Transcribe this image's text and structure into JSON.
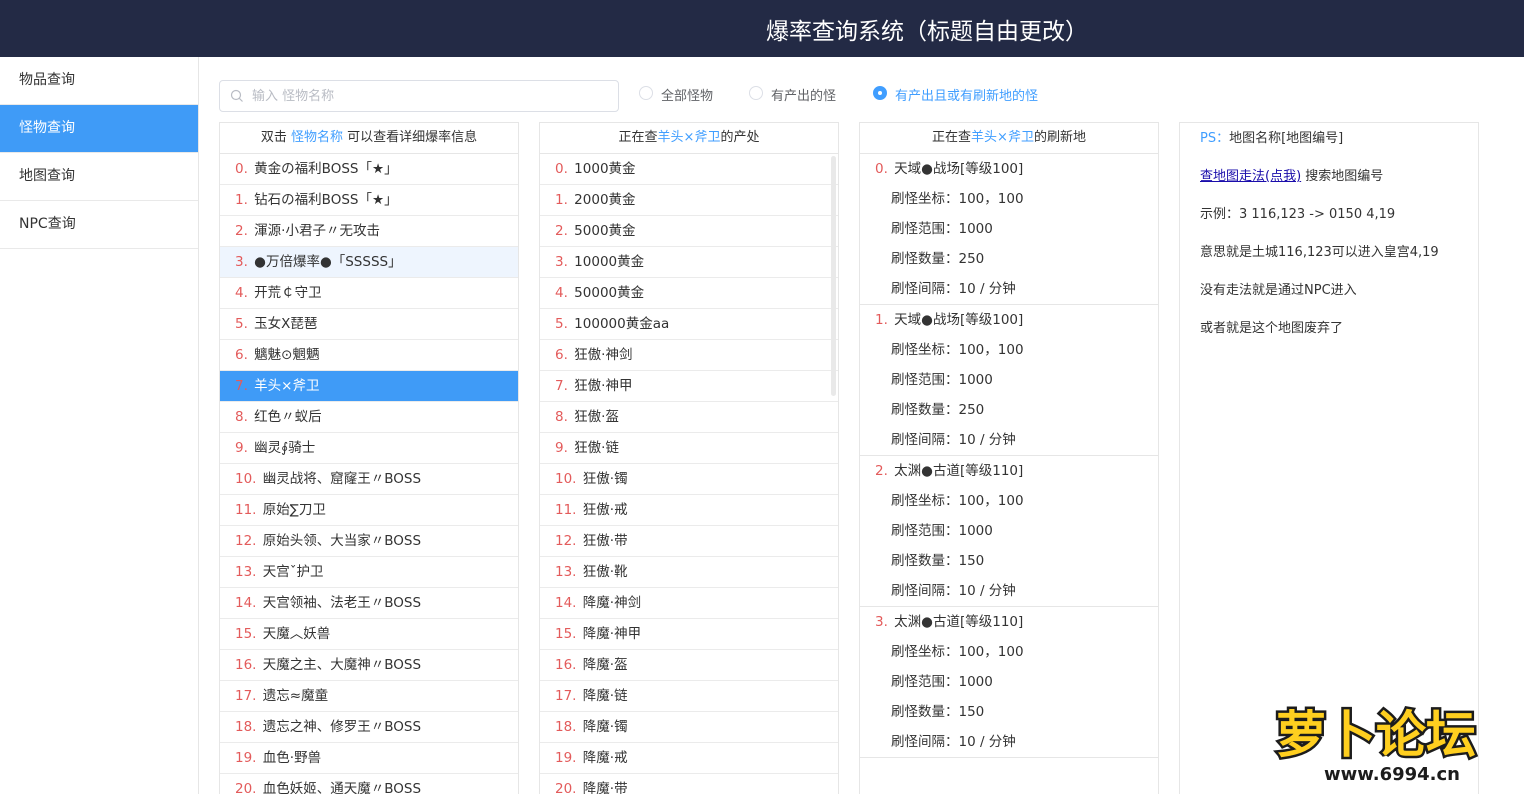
{
  "header": {
    "title": "爆率查询系统（标题自由更改）"
  },
  "sidebar": {
    "items": [
      {
        "label": "物品查询"
      },
      {
        "label": "怪物查询"
      },
      {
        "label": "地图查询"
      },
      {
        "label": "NPC查询"
      }
    ],
    "active_index": 1
  },
  "search": {
    "placeholder": "输入 怪物名称",
    "value": ""
  },
  "filters": [
    {
      "label": "全部怪物",
      "checked": false
    },
    {
      "label": "有产出的怪",
      "checked": false
    },
    {
      "label": "有产出且或有刷新地的怪",
      "checked": true
    }
  ],
  "monster_panel": {
    "head_pre": "双击",
    "head_hl": "怪物名称",
    "head_post": "可以查看详细爆率信息",
    "selected_index": 7,
    "hover_index": 3,
    "items": [
      {
        "idx": "0.",
        "name": "黄金の福利BOSS「★」"
      },
      {
        "idx": "1.",
        "name": "钻石の福利BOSS「★」"
      },
      {
        "idx": "2.",
        "name": "渾源·小君子〃无攻击"
      },
      {
        "idx": "3.",
        "name": "●万倍爆率●「SSSSS」"
      },
      {
        "idx": "4.",
        "name": "开荒￠守卫"
      },
      {
        "idx": "5.",
        "name": "玉女Ⅹ琵琶"
      },
      {
        "idx": "6.",
        "name": "魑魅⊙魍魉"
      },
      {
        "idx": "7.",
        "name": "羊头×斧卫"
      },
      {
        "idx": "8.",
        "name": "红色〃蚁后"
      },
      {
        "idx": "9.",
        "name": "幽灵∮骑士"
      },
      {
        "idx": "10.",
        "name": "幽灵战将、窟窿王〃BOSS"
      },
      {
        "idx": "11.",
        "name": "原始∑刀卫"
      },
      {
        "idx": "12.",
        "name": "原始头领、大当家〃BOSS"
      },
      {
        "idx": "13.",
        "name": "天宫ˇ护卫"
      },
      {
        "idx": "14.",
        "name": "天宫领袖、法老王〃BOSS"
      },
      {
        "idx": "15.",
        "name": "天魔︿妖兽"
      },
      {
        "idx": "16.",
        "name": "天魔之主、大魔神〃BOSS"
      },
      {
        "idx": "17.",
        "name": "遗忘≈魔童"
      },
      {
        "idx": "18.",
        "name": "遗忘之神、修罗王〃BOSS"
      },
      {
        "idx": "19.",
        "name": "血色·野兽"
      },
      {
        "idx": "20.",
        "name": "血色妖姬、通天魔〃BOSS"
      }
    ]
  },
  "drop_panel": {
    "head_pre": "正在查",
    "head_hl": "羊头×斧卫",
    "head_post": "的产处",
    "items": [
      {
        "idx": "0.",
        "name": "1000黄金"
      },
      {
        "idx": "1.",
        "name": "2000黄金"
      },
      {
        "idx": "2.",
        "name": "5000黄金"
      },
      {
        "idx": "3.",
        "name": "10000黄金"
      },
      {
        "idx": "4.",
        "name": "50000黄金"
      },
      {
        "idx": "5.",
        "name": "100000黄金aa"
      },
      {
        "idx": "6.",
        "name": "狂傲·神剑"
      },
      {
        "idx": "7.",
        "name": "狂傲·神甲"
      },
      {
        "idx": "8.",
        "name": "狂傲·盔"
      },
      {
        "idx": "9.",
        "name": "狂傲·链"
      },
      {
        "idx": "10.",
        "name": "狂傲·镯"
      },
      {
        "idx": "11.",
        "name": "狂傲·戒"
      },
      {
        "idx": "12.",
        "name": "狂傲·带"
      },
      {
        "idx": "13.",
        "name": "狂傲·靴"
      },
      {
        "idx": "14.",
        "name": "降魔·神剑"
      },
      {
        "idx": "15.",
        "name": "降魔·神甲"
      },
      {
        "idx": "16.",
        "name": "降魔·盔"
      },
      {
        "idx": "17.",
        "name": "降魔·链"
      },
      {
        "idx": "18.",
        "name": "降魔·镯"
      },
      {
        "idx": "19.",
        "name": "降魔·戒"
      },
      {
        "idx": "20.",
        "name": "降魔·带"
      }
    ]
  },
  "map_panel": {
    "head_pre": "正在查",
    "head_hl": "羊头×斧卫",
    "head_post": "的刷新地",
    "entries": [
      {
        "idx": "0.",
        "name": "天域●战场[等级100]",
        "coord": "刷怪坐标：100，100",
        "range": "刷怪范围：1000",
        "count": "刷怪数量：250",
        "interval": "刷怪间隔：10 / 分钟"
      },
      {
        "idx": "1.",
        "name": "天域●战场[等级100]",
        "coord": "刷怪坐标：100，100",
        "range": "刷怪范围：1000",
        "count": "刷怪数量：250",
        "interval": "刷怪间隔：10 / 分钟"
      },
      {
        "idx": "2.",
        "name": "太渊●古道[等级110]",
        "coord": "刷怪坐标：100，100",
        "range": "刷怪范围：1000",
        "count": "刷怪数量：150",
        "interval": "刷怪间隔：10 / 分钟"
      },
      {
        "idx": "3.",
        "name": "太渊●古道[等级110]",
        "coord": "刷怪坐标：100，100",
        "range": "刷怪范围：1000",
        "count": "刷怪数量：150",
        "interval": "刷怪间隔：10 / 分钟"
      }
    ]
  },
  "notes": {
    "ps_label": "PS：",
    "ps_text": "地图名称[地图编号]",
    "link_text": "查地图走法(点我)",
    "link_after": "搜索地图编号",
    "example": "示例：3 116,123 -> 0150 4,19",
    "meaning": "意思就是土城116,123可以进入皇宫4,19",
    "no_route": "没有走法就是通过NPC进入",
    "abandoned": "或者就是这个地图废弃了"
  },
  "watermark": {
    "brand": "萝卜论坛",
    "url": "www.6994.cn"
  },
  "colors": {
    "accent": "#409eff",
    "sidebar_active": "#3f9bf7",
    "header_bg": "#232a45",
    "index_red": "#e35b5b"
  }
}
